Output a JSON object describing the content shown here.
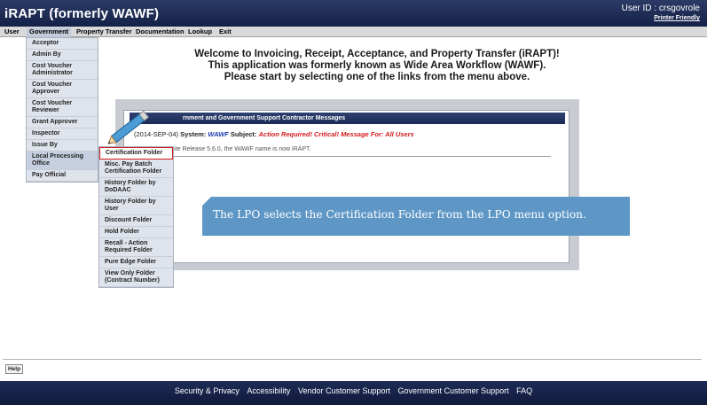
{
  "header": {
    "app_title": "iRAPT (formerly WAWF)",
    "user_id_label": "User ID :",
    "user_id": "crsgovrole",
    "printer_friendly": "Printer Friendly"
  },
  "menubar": {
    "items": [
      "User",
      "Government",
      "Property Transfer",
      "Documentation",
      "Lookup",
      "Exit"
    ]
  },
  "government_menu": {
    "items": [
      "Acceptor",
      "Admin By",
      "Cost Voucher Administrator",
      "Cost Voucher Approver",
      "Cost Voucher Reviewer",
      "Grant Approver",
      "Inspector",
      "Issue By",
      "Local Processing Office",
      "Pay Official"
    ]
  },
  "lpo_menu": {
    "items": [
      "Certification Folder",
      "Misc. Pay Batch Certification Folder",
      "History Folder by DoDAAC",
      "History Folder by User",
      "Discount Folder",
      "Hold Folder",
      "Recall - Action Required Folder",
      "Pure Edge Folder",
      "View Only Folder (Contract Number)"
    ]
  },
  "welcome": {
    "line1": "Welcome to Invoicing, Receipt, Acceptance, and Property Transfer (iRAPT)!",
    "line2": "This application was formerly known as Wide Area Workflow (WAWF).",
    "line3": "Please start by selecting one of the links from the menu above."
  },
  "messages": {
    "header": "rnment and Government Support Contractor Messages",
    "date": "(2014-SEP-04)",
    "system_label": "System:",
    "system_value": "WAWF",
    "subject_label": "Subject:",
    "subject_value": "Action Required!  Critical!  Message For: All Users",
    "body": "e-Business Suite Release 5.6.0, the WAWF name is now iRAPT."
  },
  "callout": {
    "text": "The LPO selects the Certification Folder from the LPO menu option."
  },
  "help_label": "Help",
  "footer": {
    "links": [
      "Security & Privacy",
      "Accessibility",
      "Vendor Customer Support",
      "Government Customer Support",
      "FAQ"
    ]
  },
  "colors": {
    "header_bg": "#142046",
    "callout_bg": "#5e97c6",
    "highlight_border": "#d21c1c"
  }
}
